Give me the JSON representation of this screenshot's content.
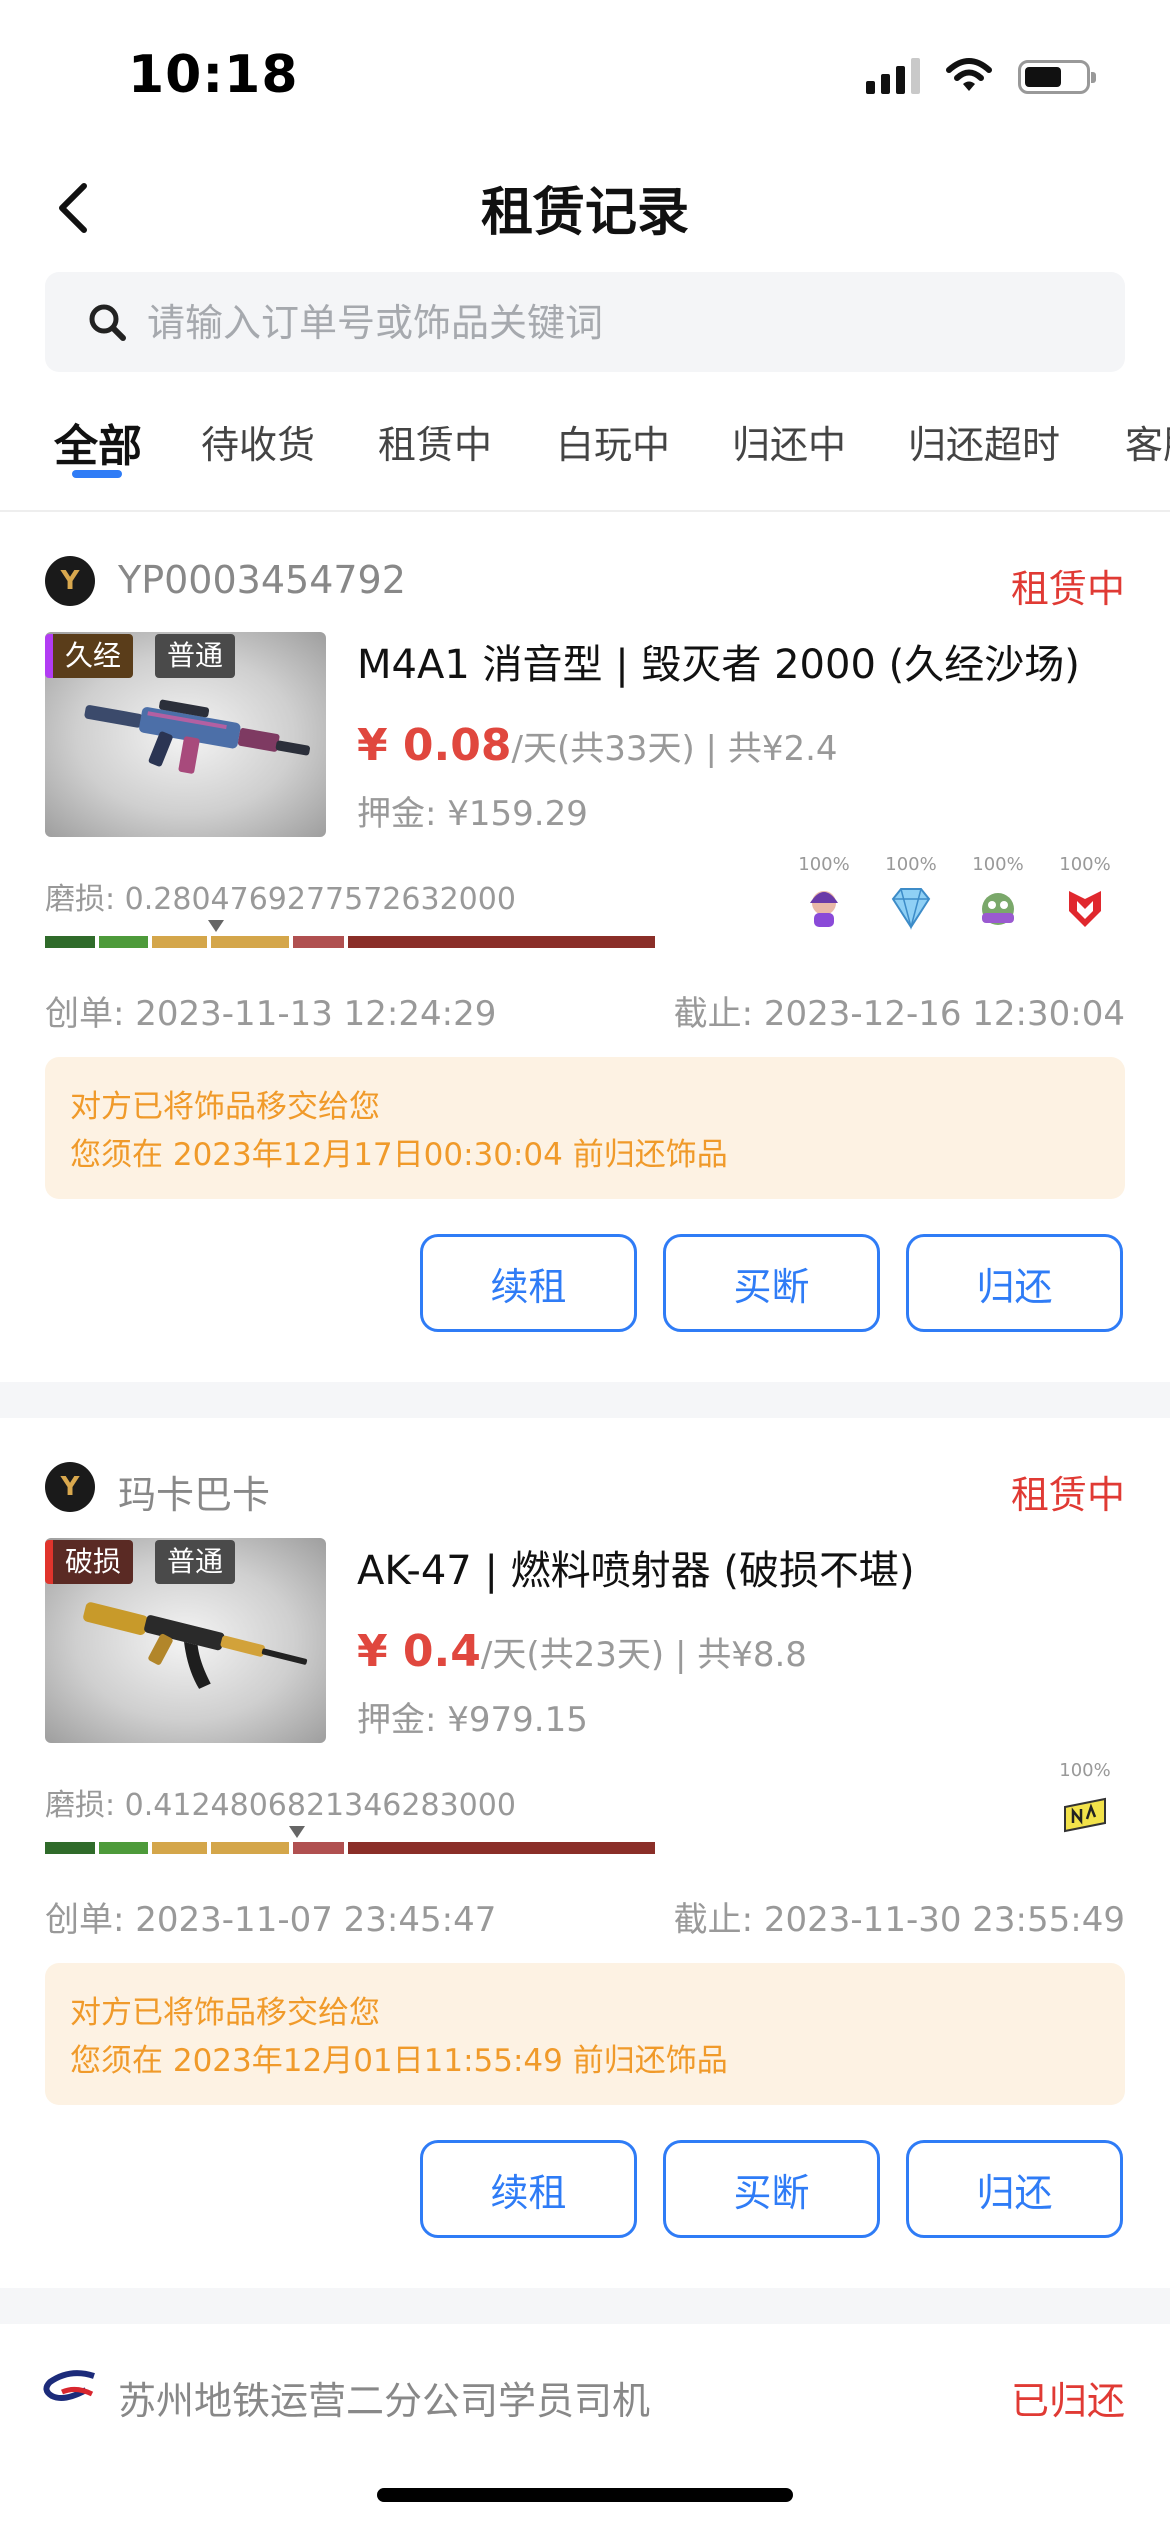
{
  "status_bar": {
    "time": "10:18"
  },
  "nav": {
    "title": "租赁记录"
  },
  "search": {
    "placeholder": "请输入订单号或饰品关键词"
  },
  "tabs": [
    "全部",
    "待收货",
    "租赁中",
    "白玩中",
    "归还中",
    "归还超时",
    "客服"
  ],
  "colors": {
    "accent": "#2f7cf6",
    "status_red": "#e03a34",
    "price_red": "#e0473e",
    "notice_bg": "#fdf2e3",
    "notice_text": "#f09a2a"
  },
  "orders": [
    {
      "shop": "YP0003454792",
      "status": "租赁中",
      "badges": [
        "久经",
        "普通"
      ],
      "title": "M4A1 消音型 | 毁灭者 2000 (久经沙场)",
      "price_amount": "¥ 0.08",
      "price_rest": "/天(共33天) | 共¥2.4",
      "deposit": "押金: ¥159.29",
      "wear_label": "磨损: 0.2804769277572632000",
      "wear_value": 0.2804769277572632,
      "stickers": [
        {
          "pct": "100%",
          "icon": "character-sticker-icon"
        },
        {
          "pct": "100%",
          "icon": "diamond-sticker-icon"
        },
        {
          "pct": "100%",
          "icon": "monster-sticker-icon"
        },
        {
          "pct": "100%",
          "icon": "mousesports-sticker-icon"
        }
      ],
      "created": "创单: 2023-11-13 12:24:29",
      "deadline": "截止: 2023-12-16 12:30:04",
      "notice_1": "对方已将饰品移交给您",
      "notice_2": "您须在 2023年12月17日00:30:04 前归还饰品",
      "buttons": [
        "续租",
        "买断",
        "归还"
      ]
    },
    {
      "shop": "玛卡巴卡",
      "status": "租赁中",
      "badges": [
        "破损",
        "普通"
      ],
      "title": "AK-47 | 燃料喷射器 (破损不堪)",
      "price_amount": "¥ 0.4",
      "price_rest": "/天(共23天) | 共¥8.8",
      "deposit": "押金: ¥979.15",
      "wear_label": "磨损: 0.4124806821346283000",
      "wear_value": 0.4124806821346283,
      "stickers": [
        {
          "pct": "100%",
          "icon": "navi-sticker-icon"
        }
      ],
      "created": "创单: 2023-11-07 23:45:47",
      "deadline": "截止: 2023-11-30 23:55:49",
      "notice_1": "对方已将饰品移交给您",
      "notice_2": "您须在 2023年12月01日11:55:49 前归还饰品",
      "buttons": [
        "续租",
        "买断",
        "归还"
      ]
    },
    {
      "shop": "苏州地铁运营二分公司学员司机",
      "status": "已归还"
    }
  ]
}
